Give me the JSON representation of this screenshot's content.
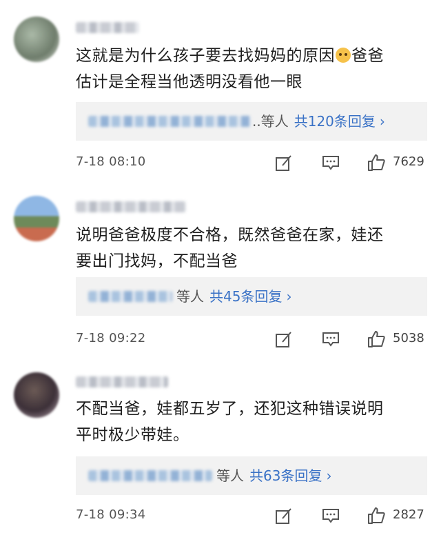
{
  "comments": [
    {
      "text_line1": "这就是为什么孩子要去找妈妈的原因",
      "emoji": "doge-emoji",
      "text_line1_tail": "爸爸",
      "text_line2": "估计是全程当他透明没看他一眼",
      "replies": {
        "names_suffix": "..等人",
        "count_label": "共120条回复"
      },
      "time": "7-18 08:10",
      "likes": "7629"
    },
    {
      "text_line1": "说明爸爸极度不合格，既然爸爸在家，娃还",
      "text_line2": "要出门找妈，不配当爸",
      "replies": {
        "names_suffix": "等人",
        "count_label": "共45条回复"
      },
      "time": "7-18 09:22",
      "likes": "5038"
    },
    {
      "text_line1": "不配当爸，娃都五岁了，还犯这种错误说明",
      "text_line2": "平时极少带娃。",
      "replies": {
        "names_suffix": "等人",
        "count_label": "共63条回复"
      },
      "time": "7-18 09:34",
      "likes": "2827"
    }
  ],
  "icons": {
    "edit": "edit-icon",
    "comment": "comment-icon",
    "like": "thumbs-up-icon",
    "more": "chevron-right-icon"
  },
  "colors": {
    "link": "#3a72c6",
    "reply_bg": "#f2f2f2",
    "meta": "#555555"
  }
}
